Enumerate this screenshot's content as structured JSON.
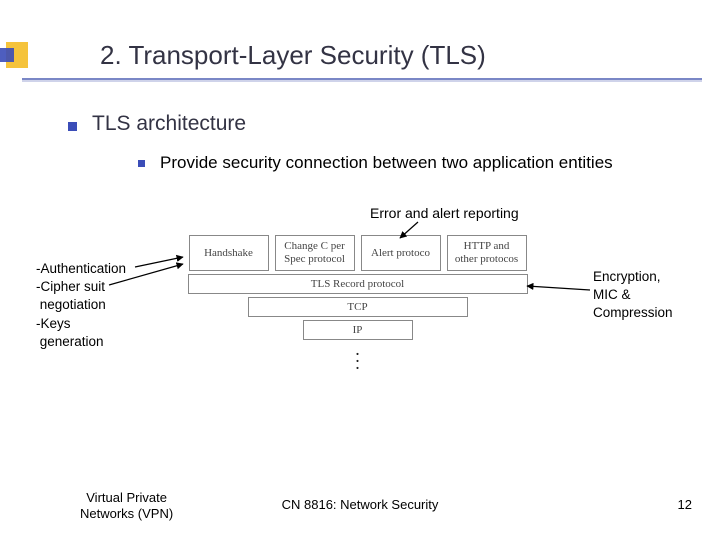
{
  "title": "2. Transport-Layer Security (TLS)",
  "bullets": {
    "l1": "TLS architecture",
    "l2": "Provide security connection between two application entities"
  },
  "annotations": {
    "top": "Error and alert reporting",
    "left_l1": "-Authentication",
    "left_l2": "-Cipher suit",
    "left_l3": " negotiation",
    "left_l4": "-Keys",
    "left_l5": " generation",
    "right_l1": "Encryption,",
    "right_l2": "MIC &",
    "right_l3": "Compression"
  },
  "diagram": {
    "top": {
      "b1": "Handshake",
      "b2": "Change C per Spec protocol",
      "b3": "Alert protoco",
      "b4": "HTTP and other protocos"
    },
    "record": "TLS Record protocol",
    "tcp": "TCP",
    "ip": "IP"
  },
  "footer": {
    "left_l1": "Virtual Private",
    "left_l2": "Networks (VPN)",
    "mid": "CN 8816: Network Security",
    "page": "12"
  }
}
